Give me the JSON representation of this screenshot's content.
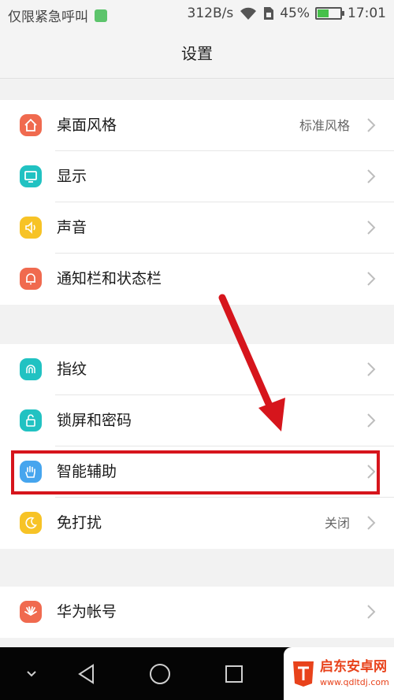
{
  "status_bar": {
    "left_text": "仅限紧急呼叫",
    "network_speed": "312B/s",
    "battery_percent": "45%",
    "battery_level": 0.45,
    "time": "17:01"
  },
  "header": {
    "title": "设置"
  },
  "groups": [
    {
      "items": [
        {
          "label": "桌面风格",
          "value": "标准风格",
          "icon": "home-icon",
          "icon_color": "#f06a4f"
        },
        {
          "label": "显示",
          "value": "",
          "icon": "display-icon",
          "icon_color": "#21c2c2"
        },
        {
          "label": "声音",
          "value": "",
          "icon": "speaker-icon",
          "icon_color": "#f7c326"
        },
        {
          "label": "通知栏和状态栏",
          "value": "",
          "icon": "bell-icon",
          "icon_color": "#f06a4f"
        }
      ]
    },
    {
      "items": [
        {
          "label": "指纹",
          "value": "",
          "icon": "fingerprint-icon",
          "icon_color": "#21c2c2"
        },
        {
          "label": "锁屏和密码",
          "value": "",
          "icon": "unlock-icon",
          "icon_color": "#21c2c2"
        },
        {
          "label": "智能辅助",
          "value": "",
          "icon": "hand-icon",
          "icon_color": "#46a5ee"
        },
        {
          "label": "免打扰",
          "value": "关闭",
          "icon": "moon-icon",
          "icon_color": "#f7c326"
        }
      ]
    },
    {
      "items": [
        {
          "label": "华为帐号",
          "value": "",
          "icon": "huawei-icon",
          "icon_color": "#f06a4f"
        }
      ]
    }
  ],
  "annotation": {
    "highlight_color": "#d6151c"
  },
  "watermark": {
    "title": "启东安卓网",
    "url": "www.qdltdj.com"
  }
}
